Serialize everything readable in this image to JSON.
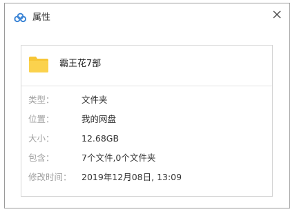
{
  "window": {
    "title": "属性",
    "close_symbol": "✕"
  },
  "file": {
    "name": "霸王花7部",
    "icon": "folder-icon",
    "icon_color": "#f7c637"
  },
  "properties": [
    {
      "label": "类型：",
      "value": "文件夹"
    },
    {
      "label": "位置：",
      "value": "我的网盘"
    },
    {
      "label": "大小：",
      "value": "12.68GB"
    },
    {
      "label": "包含：",
      "value": "7个文件,0个文件夹"
    },
    {
      "label": "修改时间：",
      "value": "2019年12月08日, 13:09"
    }
  ],
  "colors": {
    "app_icon": "#3d86d6",
    "label_text": "#a0a0a0",
    "value_text": "#333333"
  }
}
